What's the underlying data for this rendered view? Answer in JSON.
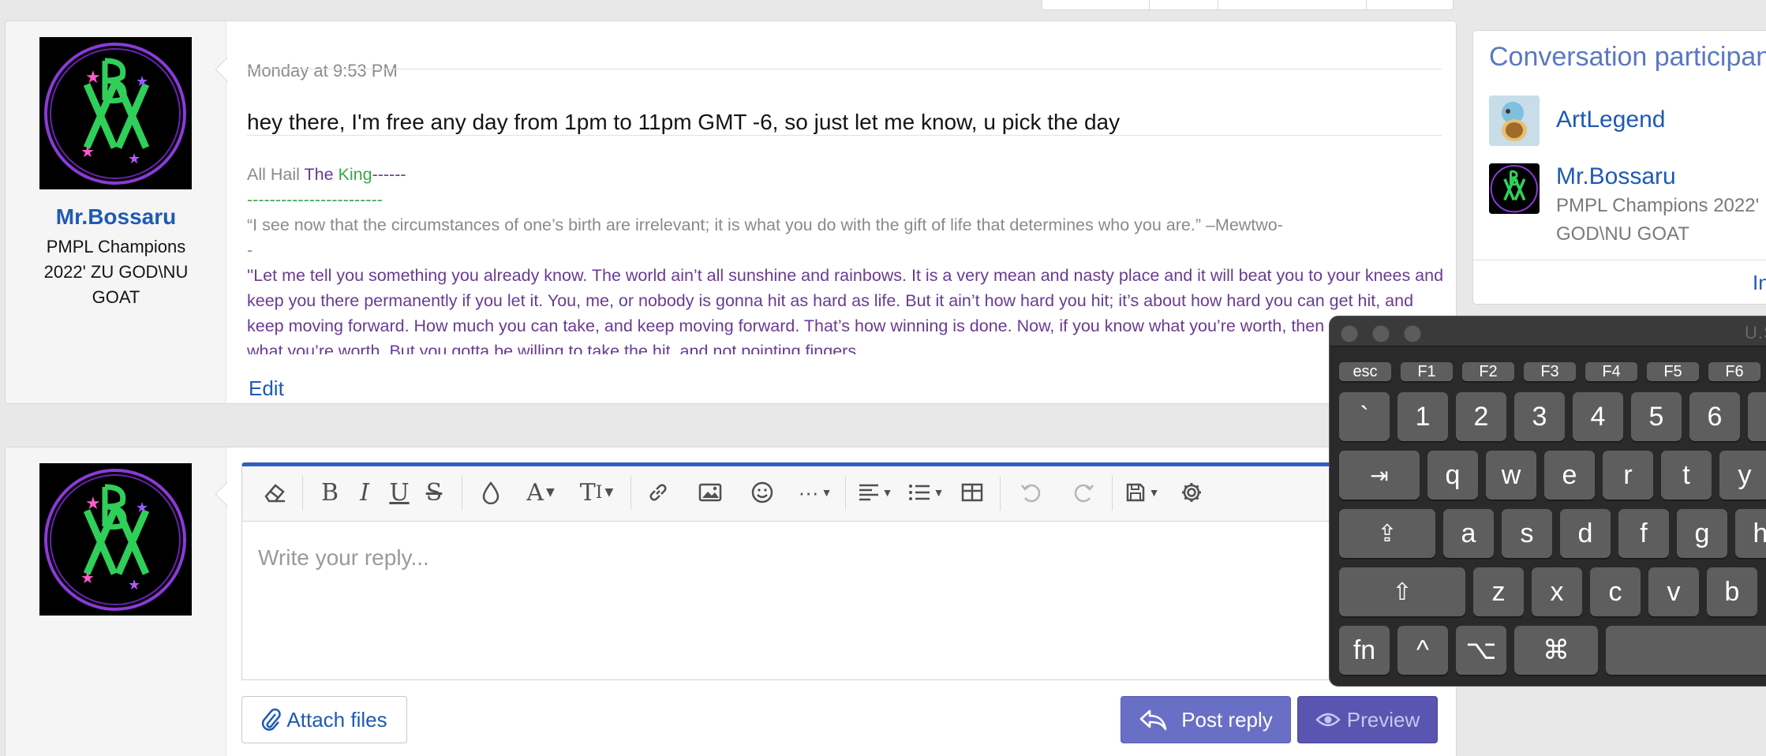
{
  "message": {
    "date": "Monday at 9:53 PM",
    "body": "hey there, I'm free any day from 1pm to 11pm GMT -6, so just let me know, u pick the day",
    "signature": {
      "line1_a": "All Hail ",
      "line1_b": "The ",
      "line1_c": "King",
      "line1_d": "------",
      "line2": "------------------------",
      "quote1": "“I see now that the circumstances of one’s birth are irrelevant; it is what you do with the gift of life that determines who you are.” –Mewtwo-",
      "quote1_tail": "-",
      "quote2": "''Let me tell you something you already know. The world ain’t all sunshine and rainbows. It is a very mean and nasty place and it will beat you to your knees and keep you there permanently if you let it. You, me, or nobody is gonna hit as hard as life. But it ain’t how hard you hit; it’s about how hard you can get hit, and keep moving forward. How much you can take, and keep moving forward. That’s how winning is done. Now, if you know what you’re worth, then go out and get what you’re worth. But you gotta be willing to take the hit, and not pointing fingers"
    },
    "edit_label": "Edit"
  },
  "author": {
    "name": "Mr.Bossaru",
    "title": "PMPL Champions 2022' ZU GOD\\NU GOAT"
  },
  "reply": {
    "placeholder": "Write your reply...",
    "attach_label": "Attach files",
    "post_label": "Post reply",
    "preview_label": "Preview"
  },
  "toolbar": {
    "icons": [
      "eraser-icon",
      "bold-icon",
      "italic-icon",
      "underline-icon",
      "strikethrough-icon",
      "text-color-icon",
      "font-family-icon",
      "font-size-icon",
      "link-icon",
      "image-icon",
      "smilies-icon",
      "more-icon",
      "align-icon",
      "list-icon",
      "table-icon",
      "undo-icon",
      "redo-icon",
      "drafts-icon",
      "settings-icon"
    ]
  },
  "participants": {
    "title": "Conversation participants",
    "people": [
      {
        "name": "ArtLegend"
      },
      {
        "name": "Mr.Bossaru",
        "sub1": "PMPL Champions 2022'",
        "sub2": "GOD\\NU GOAT"
      }
    ],
    "footer_link": "In"
  },
  "keyboard": {
    "title": "U.S.",
    "fn_row": [
      "esc",
      "F1",
      "F2",
      "F3",
      "F4",
      "F5",
      "F6"
    ],
    "num_row": [
      "`",
      "1",
      "2",
      "3",
      "4",
      "5",
      "6"
    ],
    "row_q": [
      "q",
      "w",
      "e",
      "r",
      "t",
      "y"
    ],
    "row_a": [
      "a",
      "s",
      "d",
      "f",
      "g",
      "h"
    ],
    "row_z": [
      "z",
      "x",
      "c",
      "v",
      "b"
    ],
    "mods": [
      "fn",
      "^",
      "⌥",
      "⌘"
    ]
  },
  "colors": {
    "link": "#1e5ab4",
    "editor_accent": "#2f5fc2",
    "post_button": "#6a6fc6",
    "preview_button": "#5a55b0",
    "sig_purple": "#6a3a94",
    "sig_green": "#3aa84a"
  }
}
